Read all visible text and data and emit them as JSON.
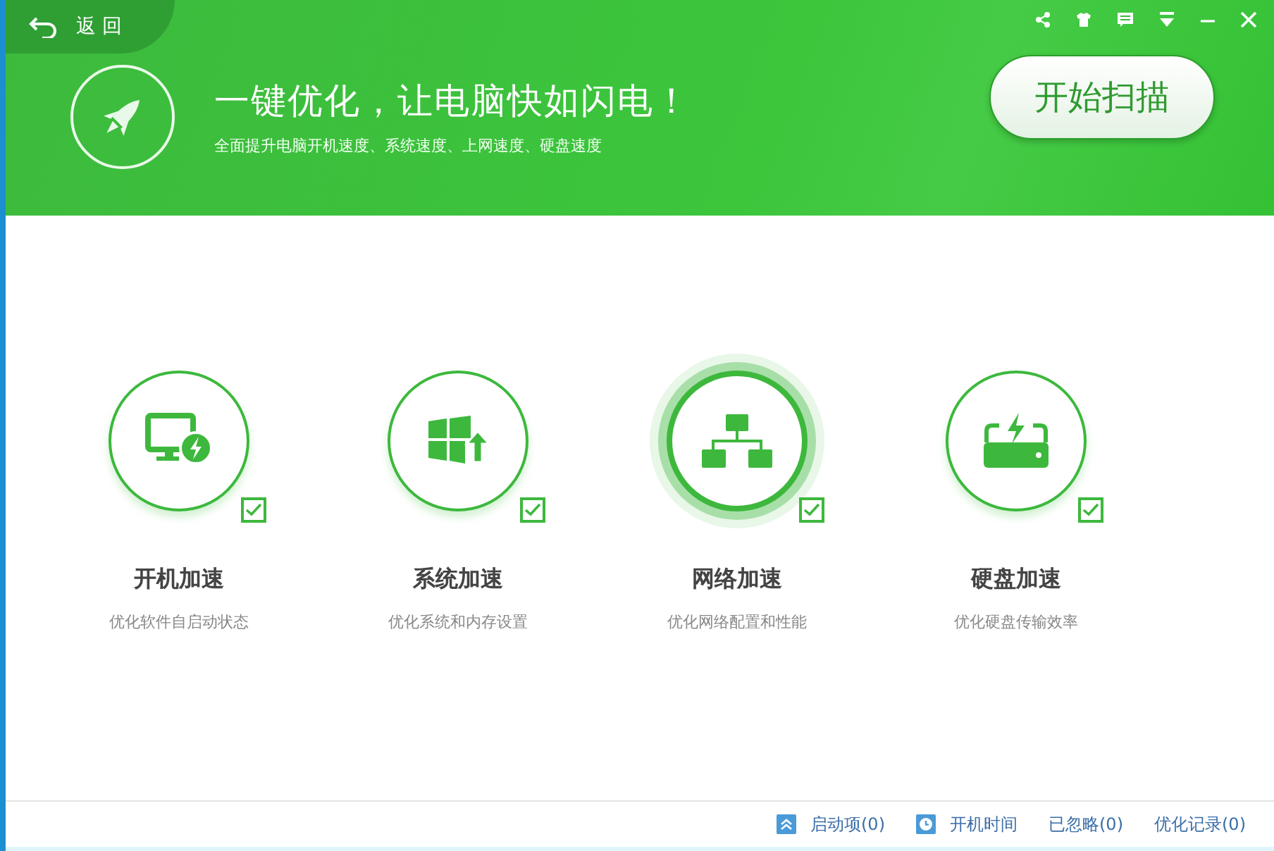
{
  "back": {
    "label": "返 回"
  },
  "header": {
    "title": "一键优化，让电脑快如闪电！",
    "subtitle": "全面提升电脑开机速度、系统速度、上网速度、硬盘速度",
    "scan_button": "开始扫描"
  },
  "items": [
    {
      "kind": "startup",
      "title": "开机加速",
      "desc": "优化软件自启动状态",
      "checked": true,
      "selected": false
    },
    {
      "kind": "system",
      "title": "系统加速",
      "desc": "优化系统和内存设置",
      "checked": true,
      "selected": false
    },
    {
      "kind": "network",
      "title": "网络加速",
      "desc": "优化网络配置和性能",
      "checked": true,
      "selected": true
    },
    {
      "kind": "disk",
      "title": "硬盘加速",
      "desc": "优化硬盘传输效率",
      "checked": true,
      "selected": false
    }
  ],
  "footer": [
    {
      "kind": "startup",
      "label": "启动项(0)"
    },
    {
      "kind": "boottime",
      "label": "开机时间"
    },
    {
      "kind": "plain",
      "label": "已忽略(0)"
    },
    {
      "kind": "plain",
      "label": "优化记录(0)"
    }
  ]
}
